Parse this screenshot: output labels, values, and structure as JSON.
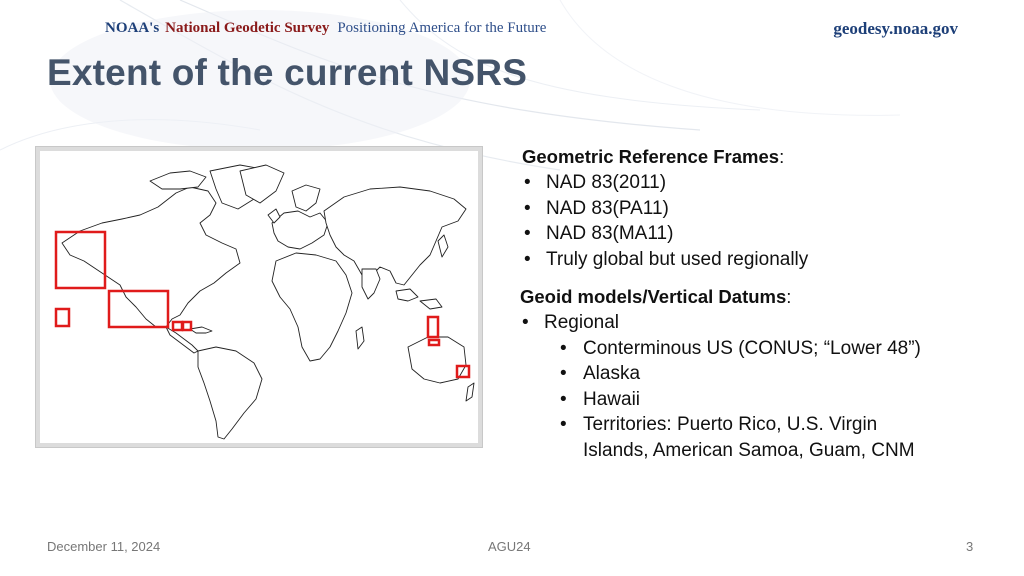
{
  "header": {
    "brand_noaa": "NOAA's",
    "brand_ngs": "National Geodetic Survey",
    "brand_tagline": "Positioning America for the Future",
    "site": "geodesy.noaa.gov"
  },
  "title": "Extent of the current NSRS",
  "map": {
    "icon": "world-map",
    "highlight_color": "#e01b1b",
    "highlighted_regions": [
      "Alaska",
      "Conterminous US",
      "Hawaii",
      "Puerto Rico / U.S. Virgin Islands",
      "Guam / CNMI",
      "American Samoa"
    ]
  },
  "frames": {
    "heading": "Geometric Reference Frames",
    "heading_suffix": ":",
    "items": [
      "NAD 83(2011)",
      "NAD 83(PA11)",
      "NAD 83(MA11)",
      "Truly global but used regionally"
    ]
  },
  "geoid": {
    "heading": "Geoid models/Vertical Datums",
    "heading_suffix": ":",
    "regional": "Regional",
    "sub_items": [
      "Conterminous US (CONUS; “Lower 48”)",
      "Alaska",
      "Hawaii",
      "Territories:  Puerto Rico, U.S. Virgin Islands, American Samoa, Guam, CNM"
    ]
  },
  "footer": {
    "date": "December 11, 2024",
    "event": "AGU24",
    "page": "3"
  }
}
